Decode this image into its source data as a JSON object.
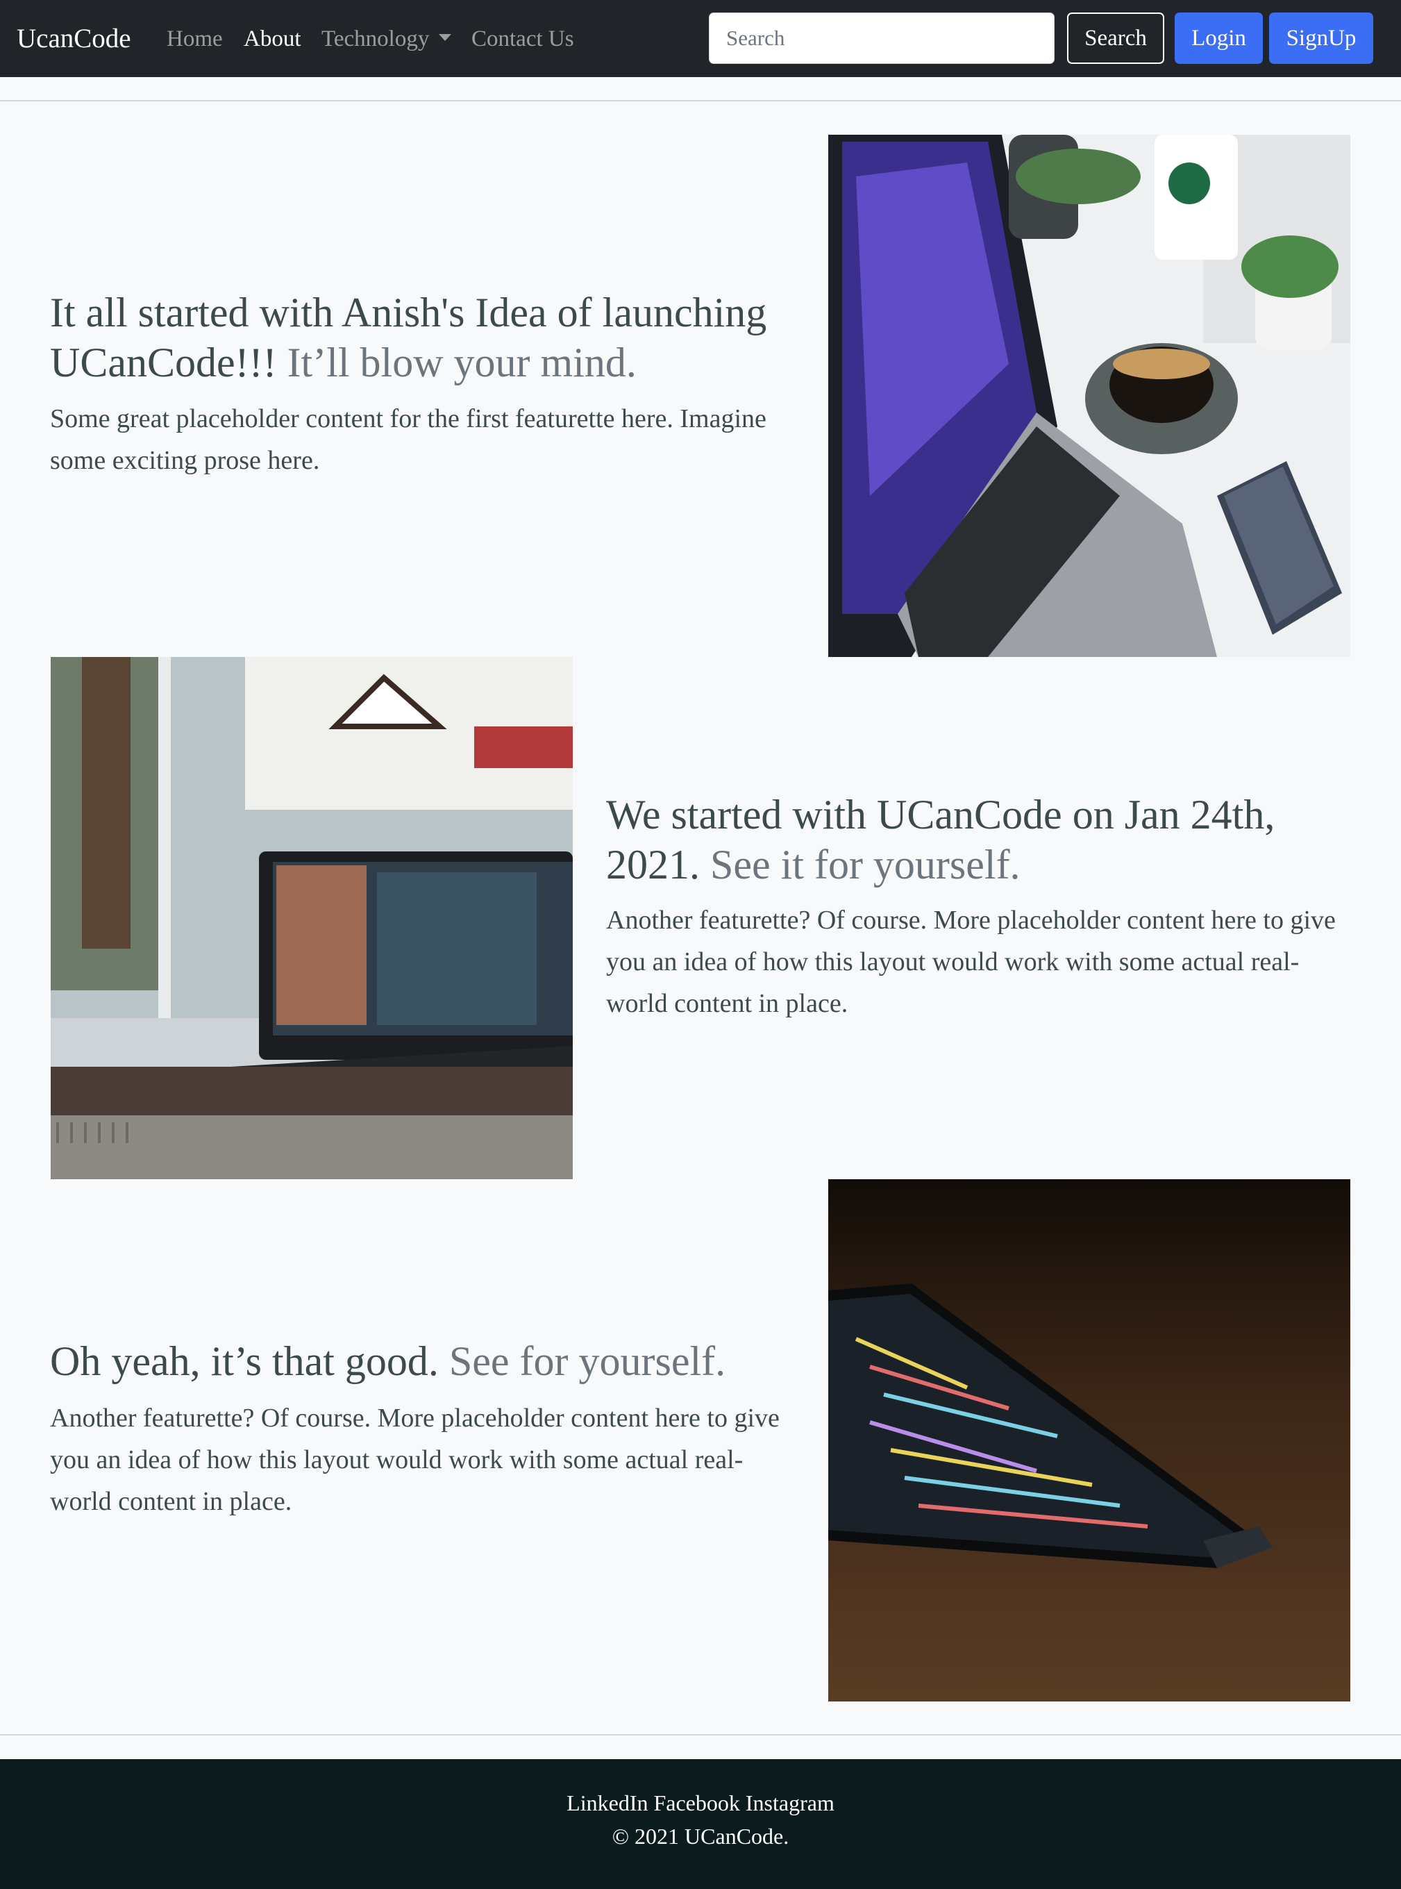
{
  "navbar": {
    "brand": "UcanCode",
    "links": [
      "Home",
      "About",
      "Technology",
      "Contact Us"
    ],
    "search_placeholder": "Search",
    "search_button": "Search",
    "login_button": "Login",
    "signup_button": "SignUp"
  },
  "featurettes": [
    {
      "heading": "It all started with Anish's Idea of launching UCanCode!!!",
      "heading_muted": "It’ll blow your mind.",
      "text": "Some great placeholder content for the first featurette here. Imagine some exciting prose here."
    },
    {
      "heading": "We started with UCanCode on Jan 24th, 2021.",
      "heading_muted": "See it for yourself.",
      "text": "Another featurette? Of course. More placeholder content here to give you an idea of how this layout would work with some actual real-world content in place."
    },
    {
      "heading": "Oh yeah, it’s that good.",
      "heading_muted": "See for yourself.",
      "text": "Another featurette? Of course. More placeholder content here to give you an idea of how this layout would work with some actual real-world content in place."
    }
  ],
  "footer": {
    "social": [
      "LinkedIn",
      "Facebook",
      "Instagram"
    ],
    "copyright": "© 2021 UCanCode."
  }
}
